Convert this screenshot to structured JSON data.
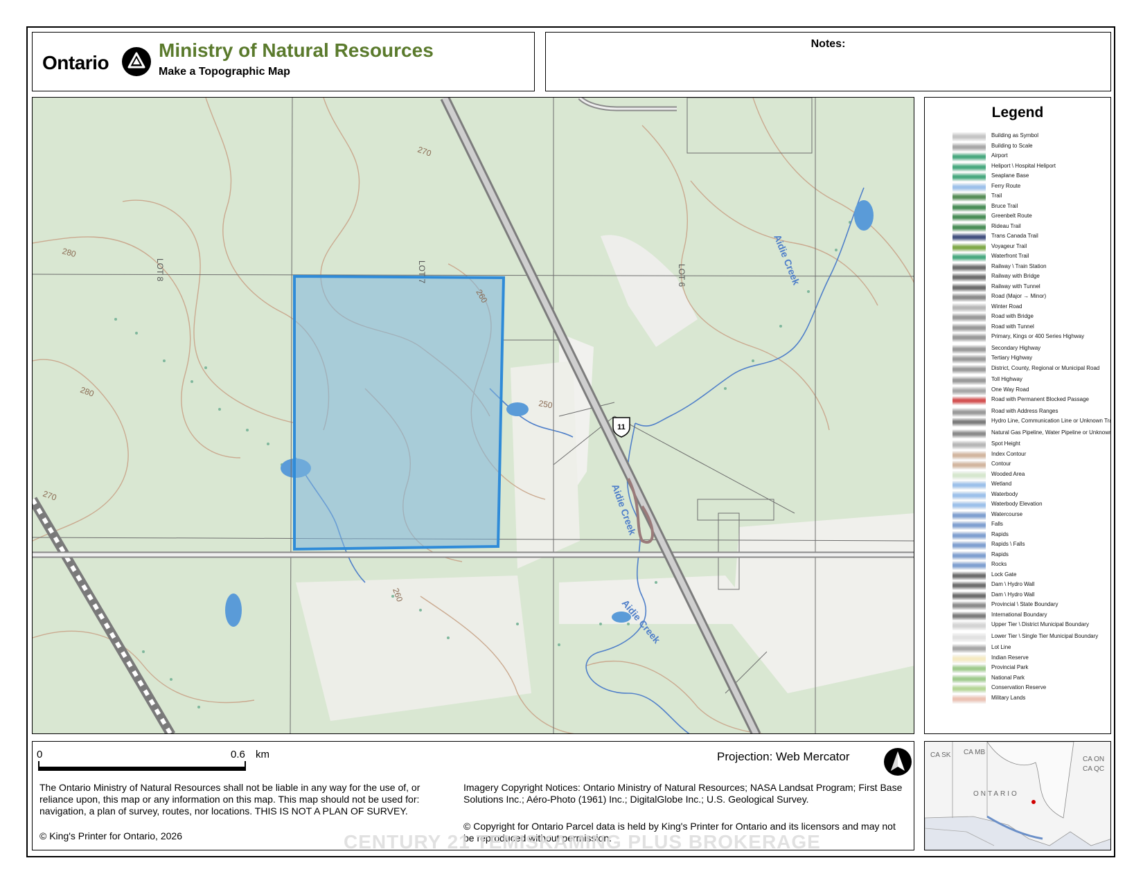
{
  "header": {
    "ontario_wordmark": "Ontario",
    "ministry_title": "Ministry of Natural Resources",
    "subtitle": "Make a Topographic Map",
    "notes_label": "Notes:",
    "ministry_color": "#5a7a2c"
  },
  "map": {
    "highway_shield": "11",
    "lot_labels": [
      "LOT 8",
      "LOT 7",
      "LOT 6"
    ],
    "creek_label": "Aidie Creek",
    "contour_labels": [
      "270",
      "280",
      "280",
      "260",
      "250",
      "270",
      "260"
    ],
    "parcel_fill": "#7fb6dc",
    "parcel_stroke": "#2f8bd8",
    "land_color": "#d7e6d0",
    "clearing_color": "#f1f1ef",
    "water_color": "#5a9bd8"
  },
  "legend": {
    "title": "Legend",
    "items": [
      "Building as Symbol",
      "Building to Scale",
      "Airport",
      "Heliport \\ Hospital Heliport",
      "Seaplane Base",
      "Ferry Route",
      "Trail",
      "Bruce Trail",
      "Greenbelt Route",
      "Rideau Trail",
      "Trans Canada Trail",
      "Voyageur Trail",
      "Waterfront Trail",
      "Railway \\ Train Station",
      "Railway with Bridge",
      "Railway with Tunnel",
      "Road (Major → Minor)",
      "Winter Road",
      "Road with Bridge",
      "Road with Tunnel",
      "Primary, Kings or 400 Series Highway",
      "Secondary Highway",
      "Tertiary Highway",
      "District, County, Regional or Municipal Road",
      "Toll Highway",
      "One Way Road",
      "Road with Permanent Blocked Passage",
      "Road with Address Ranges",
      "Hydro Line, Communication Line or Unknown Transmission Line",
      "Natural Gas Pipeline, Water Pipeline or Unknown Pipeline",
      "Spot Height",
      "Index Contour",
      "Contour",
      "Wooded Area",
      "Wetland",
      "Waterbody",
      "Waterbody Elevation",
      "Watercourse",
      "Falls",
      "Rapids",
      "Rapids \\ Falls",
      "Rapids",
      "Rocks",
      "Lock Gate",
      "Dam \\ Hydro Wall",
      "Dam \\ Hydro Wall",
      "Provincial \\ State Boundary",
      "International Boundary",
      "Upper Tier \\ District Municipal Boundary",
      "Lower Tier \\ Single Tier Municipal Boundary",
      "Lot Line",
      "Indian Reserve",
      "Provincial Park",
      "National Park",
      "Conservation Reserve",
      "Military Lands"
    ]
  },
  "footer": {
    "scale_start": "0",
    "scale_end": "0.6",
    "scale_unit": "km",
    "projection": "Projection: Web Mercator",
    "disclaimer": "The Ontario Ministry of Natural Resources shall not be liable in any way for the use of, or reliance upon, this map or any information on this map.  This map should not be used for: navigation, a plan of survey, routes, nor locations. THIS IS NOT A PLAN OF SURVEY.",
    "copyright": "© King's Printer for Ontario,  2026",
    "imagery_notice": "Imagery Copyright Notices: Ontario Ministry of Natural Resources; NASA Landsat Program; First Base Solutions Inc.; Aéro-Photo (1961) Inc.; DigitalGlobe Inc.; U.S. Geological Survey.",
    "parcel_notice": "© Copyright for Ontario Parcel data is held by King's Printer for Ontario and its licensors and may not be reproduced without permission."
  },
  "inset": {
    "labels": [
      "CA SK",
      "CA MB",
      "ONTARIO",
      "CA ON",
      "CA QC"
    ]
  },
  "watermark": "CENTURY 21 TEMISKAMING PLUS BROKERAGE"
}
